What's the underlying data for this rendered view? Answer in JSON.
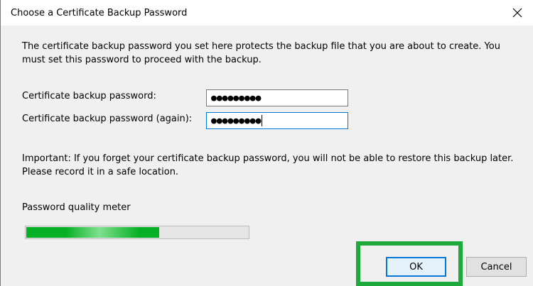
{
  "window": {
    "title": "Choose a Certificate Backup Password",
    "close_icon": "close-icon"
  },
  "description": "The certificate backup password you set here protects the backup file that you are about to create. You must set this password to proceed with the backup.",
  "fields": {
    "password_label": "Certificate backup password:",
    "password_value": "●●●●●●●●●",
    "confirm_label": "Certificate backup password (again):",
    "confirm_value": "●●●●●●●●●"
  },
  "important": "Important: If you forget your certificate backup password, you will not be able to restore this backup later. Please record it in a safe location.",
  "meter": {
    "label": "Password quality meter",
    "level_fraction": 0.6,
    "color": "#06b025"
  },
  "buttons": {
    "ok": "OK",
    "cancel": "Cancel"
  },
  "highlight_color": "#1eaa3b"
}
